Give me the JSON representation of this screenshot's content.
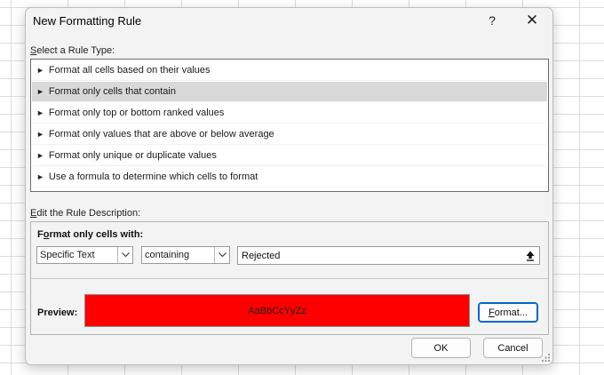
{
  "dialog": {
    "title": "New Formatting Rule",
    "help_label": "?",
    "close_label": "✕"
  },
  "rule_type": {
    "label_accel": "S",
    "label_rest": "elect a Rule Type:",
    "items": [
      {
        "label": "Format all cells based on their values"
      },
      {
        "label": "Format only cells that contain"
      },
      {
        "label": "Format only top or bottom ranked values"
      },
      {
        "label": "Format only values that are above or below average"
      },
      {
        "label": "Format only unique or duplicate values"
      },
      {
        "label": "Use a formula to determine which cells to format"
      }
    ],
    "selected_index": 1,
    "item_arrow": "►"
  },
  "description": {
    "label_accel": "E",
    "label_rest": "dit the Rule Description:",
    "heading_accel": "o",
    "heading_pre": "F",
    "heading_post": "rmat only cells with:",
    "condition_type": "Specific Text",
    "operator": "containing",
    "value": "Rejected",
    "preview_label": "Preview:",
    "preview_text": "AaBbCcYyZz",
    "preview_bg": "#ff0000",
    "format_accel": "F",
    "format_rest": "ormat..."
  },
  "footer": {
    "ok_label": "OK",
    "cancel_label": "Cancel"
  }
}
